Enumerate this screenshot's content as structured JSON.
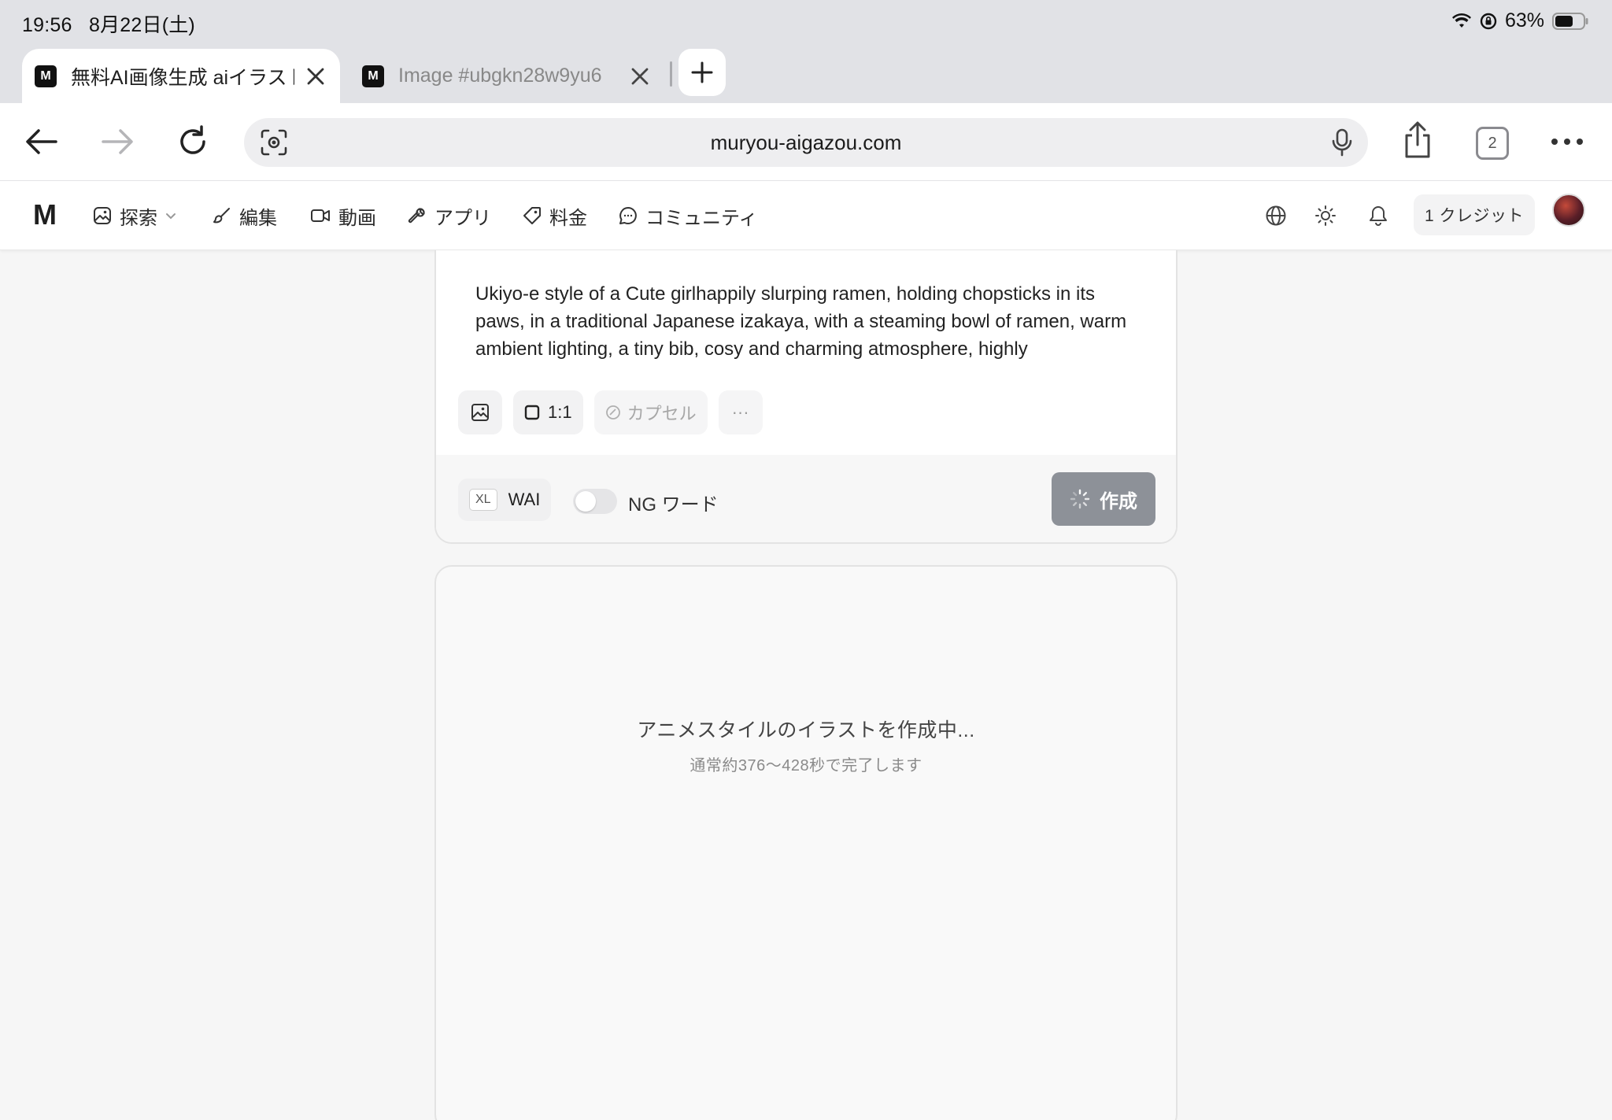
{
  "status": {
    "time": "19:56",
    "date": "8月22日(土)",
    "battery": "63%"
  },
  "tabs": [
    {
      "title": "無料AI画像生成 aiイラスト",
      "active": true
    },
    {
      "title": "Image #ubgkn28w9yu6",
      "active": false
    }
  ],
  "browser": {
    "url": "muryou-aigazou.com",
    "tab_count": "2"
  },
  "site_nav": {
    "logo": "M",
    "items": [
      {
        "label": "探索",
        "icon": "image-icon"
      },
      {
        "label": "編集",
        "icon": "brush-icon"
      },
      {
        "label": "動画",
        "icon": "video-icon"
      },
      {
        "label": "アプリ",
        "icon": "wrench-icon"
      },
      {
        "label": "料金",
        "icon": "tag-icon"
      },
      {
        "label": "コミュニティ",
        "icon": "chat-icon"
      }
    ],
    "credits": "1 クレジット"
  },
  "prompt": {
    "text": "Ukiyo-e style of a Cute girlhappily slurping ramen, holding chopsticks in its paws, in a traditional Japanese izakaya, with a steaming bowl of ramen, warm ambient lighting, a tiny bib, cosy and charming atmosphere, highly",
    "aspect_ratio": "1:1",
    "capsule_label": "カプセル",
    "more_label": "···",
    "model_badge": "XL",
    "model_name": "WAI",
    "ng_word_label": "NG ワード",
    "ng_word_enabled": false,
    "create_label": "作成"
  },
  "generation": {
    "title": "アニメスタイルのイラストを作成中...",
    "subtitle": "通常約376〜428秒で完了します"
  }
}
